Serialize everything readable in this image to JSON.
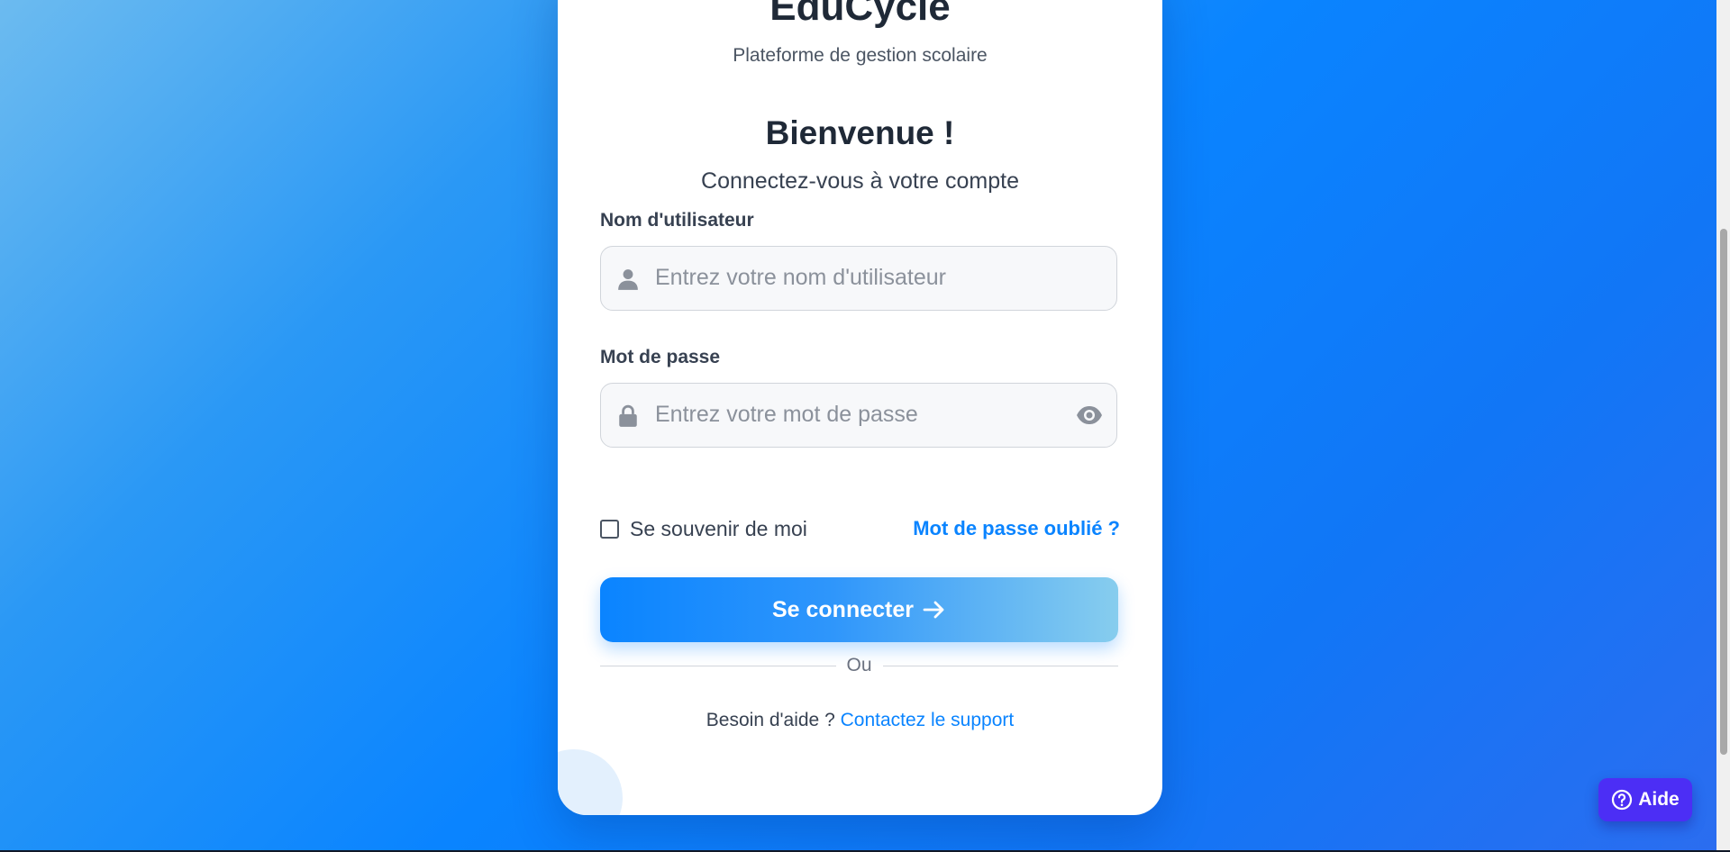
{
  "brand": {
    "name": "EduCycle",
    "tagline": "Plateforme de gestion scolaire"
  },
  "welcome": {
    "title": "Bienvenue !",
    "subtitle": "Connectez-vous à votre compte"
  },
  "form": {
    "username": {
      "label": "Nom d'utilisateur",
      "placeholder": "Entrez votre nom d'utilisateur",
      "value": "",
      "icon": "user-icon"
    },
    "password": {
      "label": "Mot de passe",
      "placeholder": "Entrez votre mot de passe",
      "value": "",
      "icon": "lock-icon",
      "toggle_icon": "eye-icon"
    },
    "remember_label": "Se souvenir de moi",
    "remember_checked": false,
    "forgot_label": "Mot de passe oublié ?",
    "submit_label": "Se connecter",
    "submit_icon": "arrow-right-icon",
    "divider_label": "Ou",
    "help_prefix": "Besoin d'aide ?",
    "support_label": "Contactez le support"
  },
  "floating_help": {
    "label": "Aide",
    "icon": "question-circle-icon"
  },
  "colors": {
    "accent": "#0a84ff",
    "help_button": "#4c2ef5",
    "text_dark": "#1f2937"
  }
}
